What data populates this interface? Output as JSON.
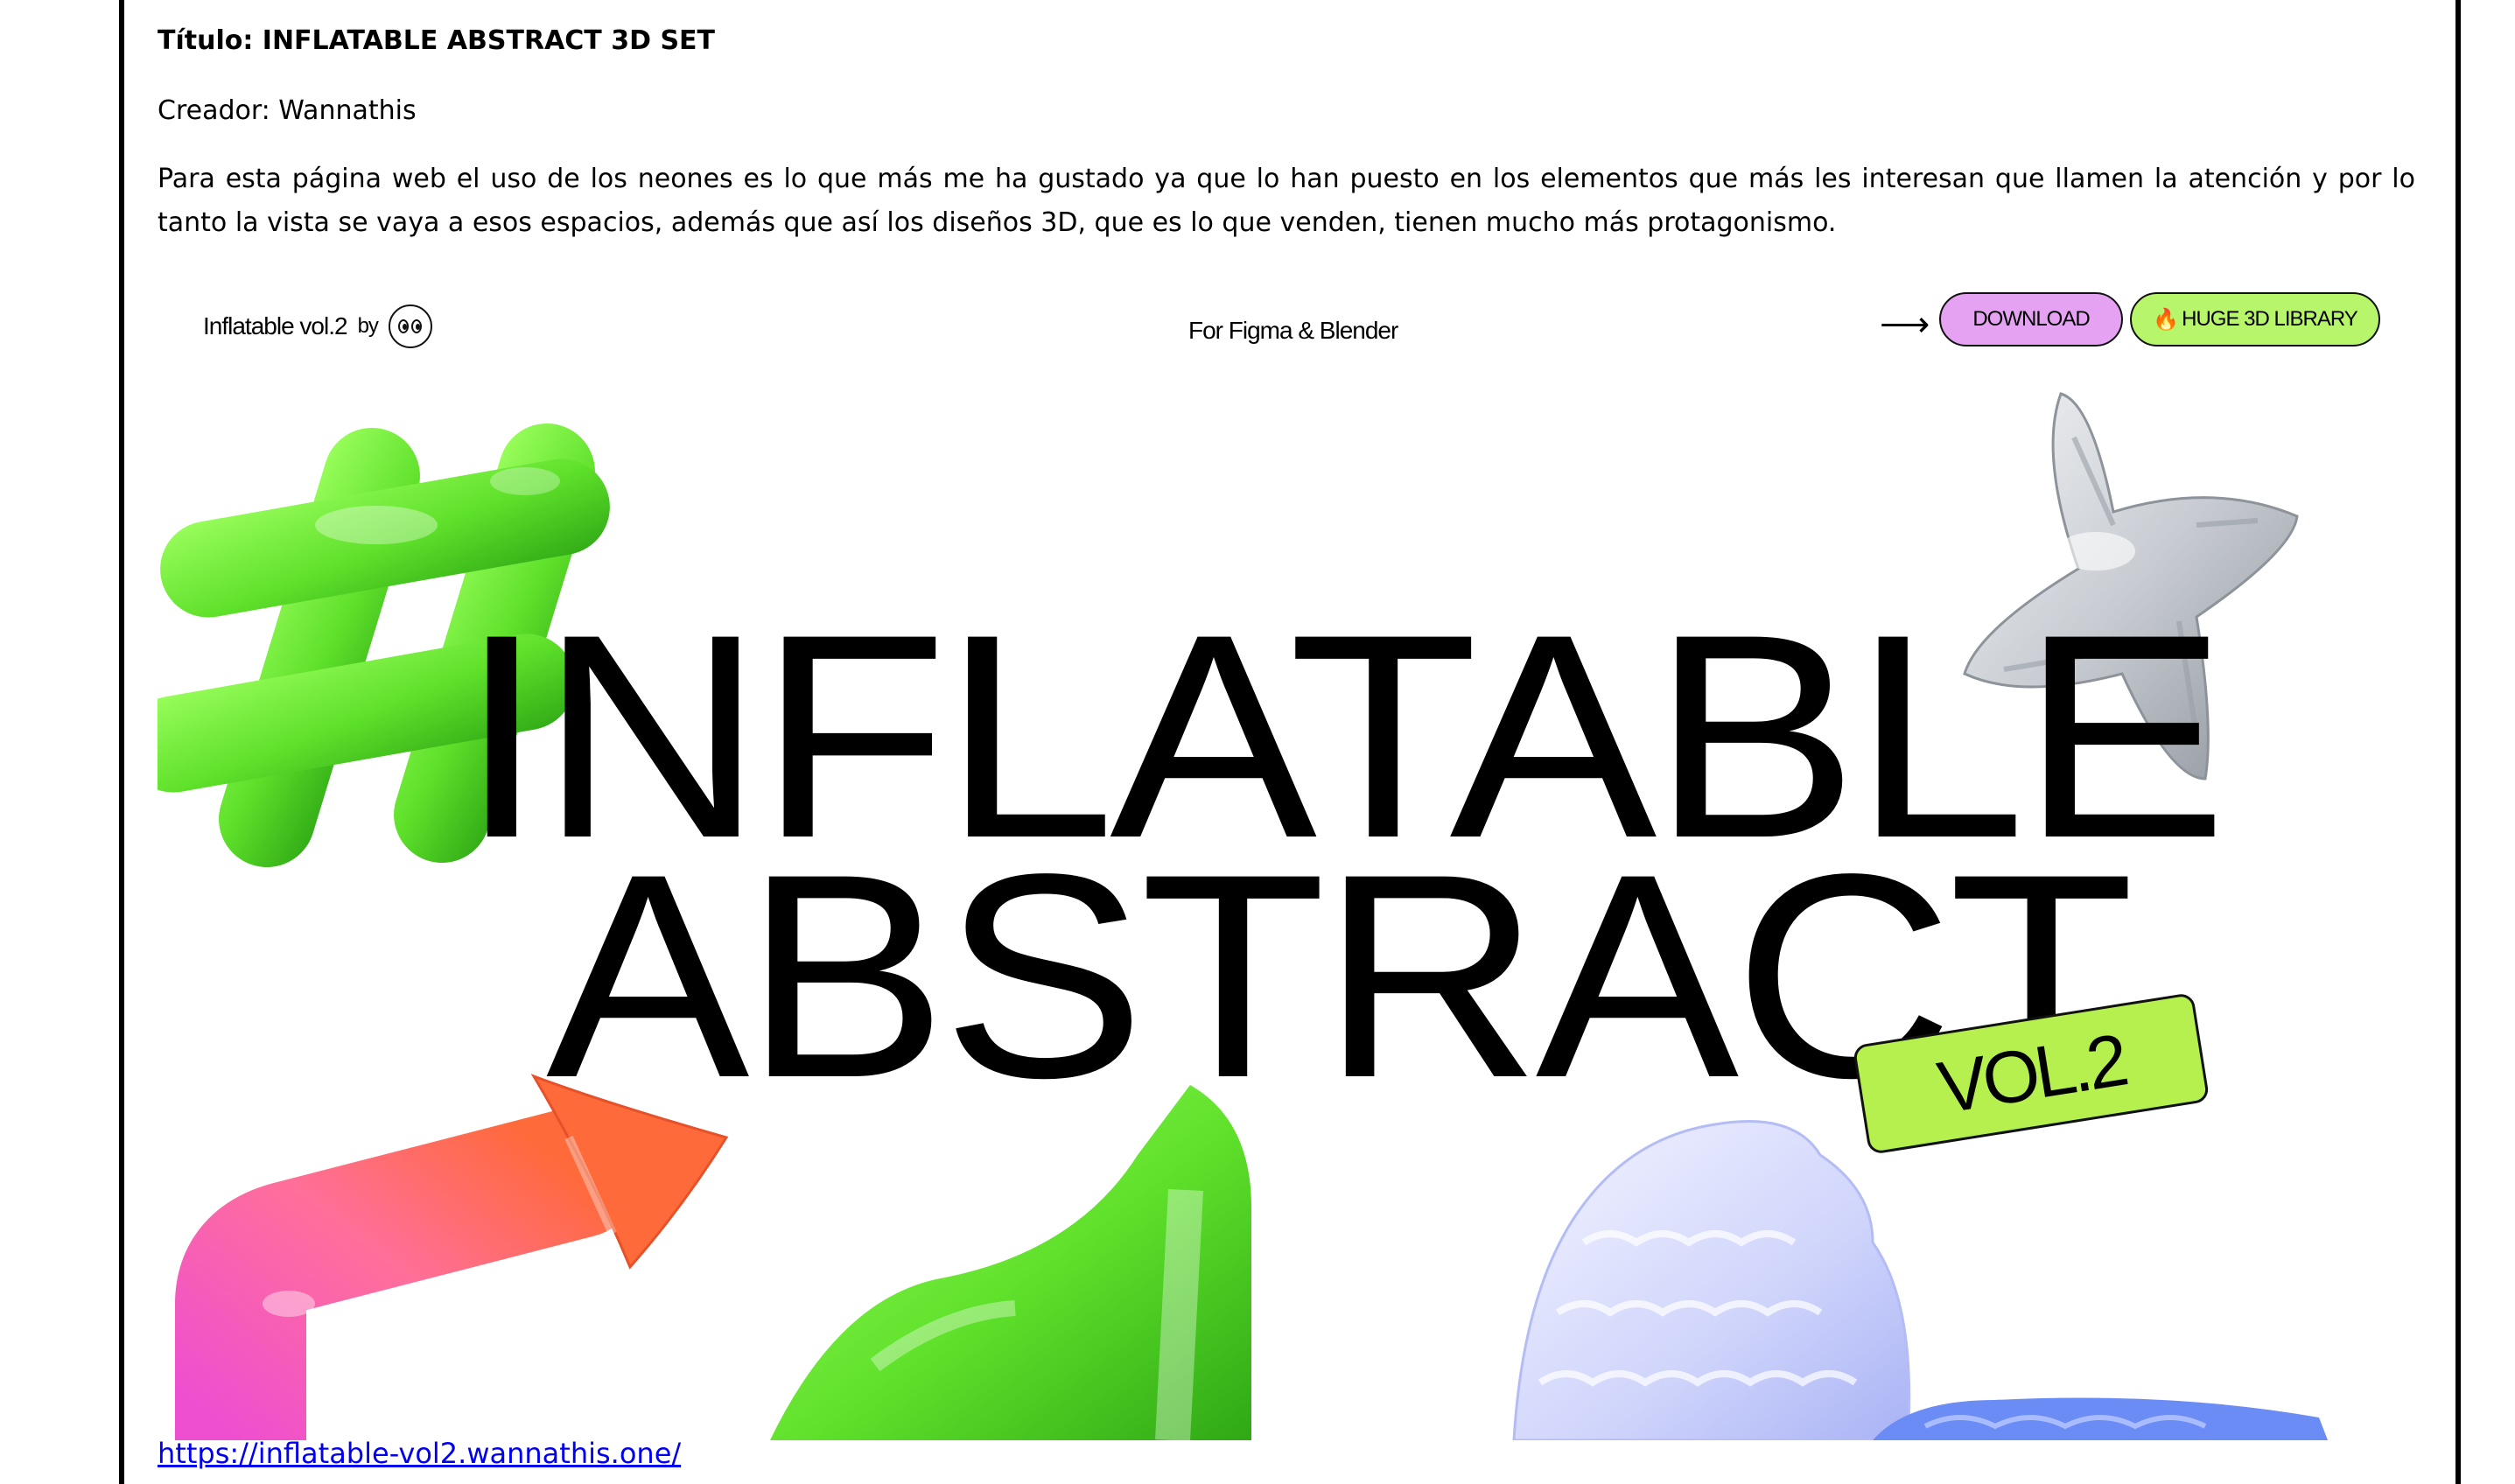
{
  "document": {
    "title_line": "Título: INFLATABLE ABSTRACT 3D SET",
    "creator_line": "Creador: Wannathis",
    "description": "Para esta página web el uso de los neones es lo que más me ha gustado ya que lo han puesto en los elementos que más les interesan que llamen la atención y por lo tanto la vista se vaya a esos espacios, además que así los diseños 3D, que es lo que venden, tienen mucho más protagonismo.",
    "link_text": "https://inflatable-vol2.wannathis.one/"
  },
  "website": {
    "brand_name": "Inflatable vol.2",
    "brand_by": "by",
    "tagline": "For Figma & Blender",
    "arrow": "⟶",
    "download_label": "DOWNLOAD",
    "library_icon": "🔥",
    "library_label": "HUGE 3D LIBRARY",
    "hero_line_1": "INFLATABLE",
    "hero_line_2": "ABSTRACT",
    "version_badge": "VOL.2"
  },
  "colors": {
    "download_pill": "#e6a2f2",
    "library_pill": "#b7f56a",
    "badge": "#b6f04f",
    "neon_green": "#5ee02a",
    "pink": "#ee4fd0",
    "orange": "#ff6a3a",
    "silver": "#c8ccd2",
    "lavender": "#cfd4fb",
    "blue": "#6b8bf5",
    "link": "#0000ee"
  },
  "icons": [
    "eyes-logo-icon",
    "arrow-right-icon",
    "fire-icon"
  ]
}
